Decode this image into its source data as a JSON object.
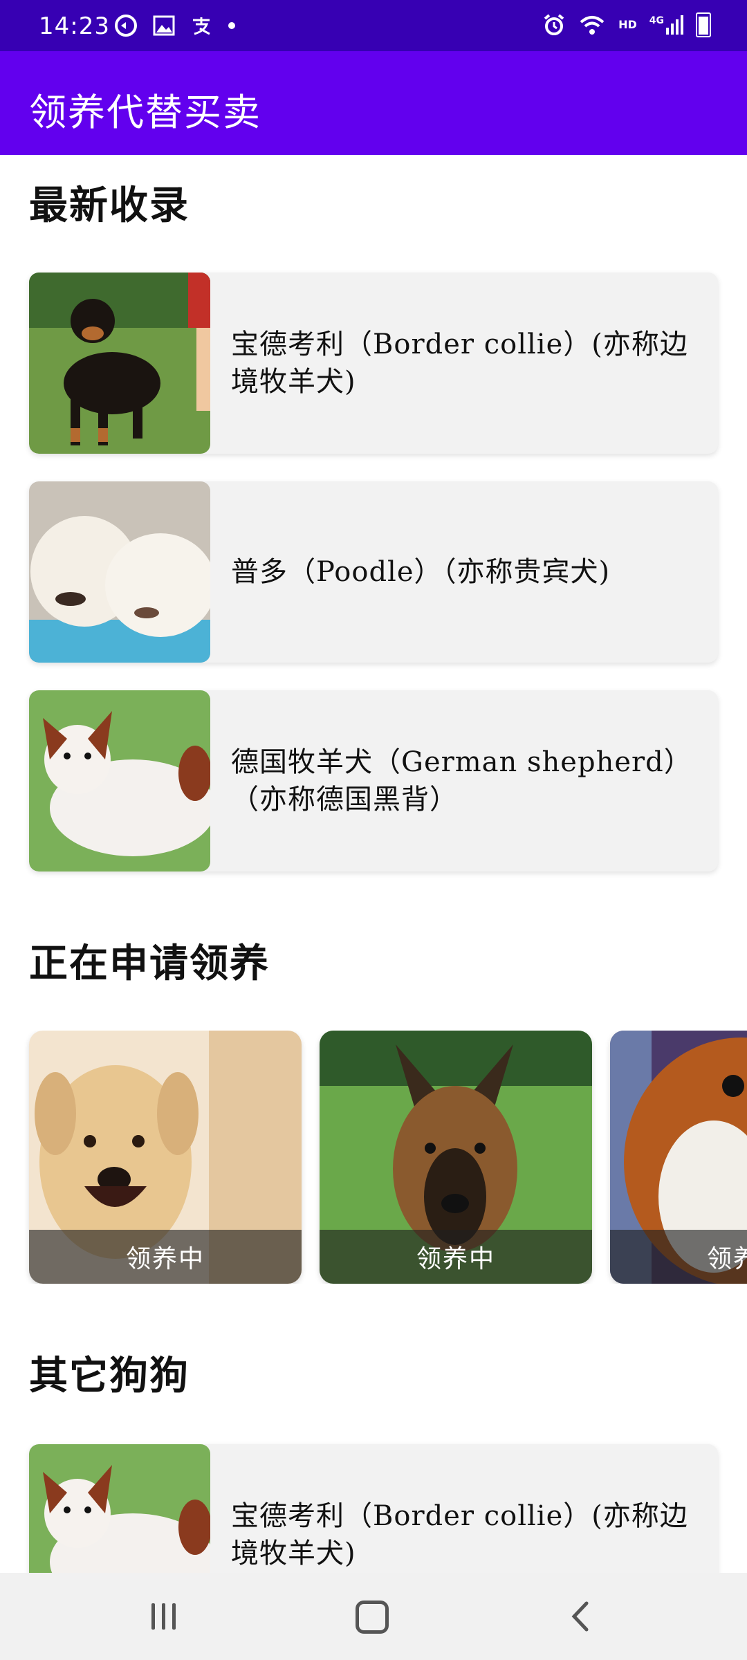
{
  "status_bar": {
    "time": "14:23",
    "left_icons": [
      "sync-icon",
      "image-icon",
      "alipay-icon",
      "dot-icon"
    ],
    "right_icons": [
      "alarm-icon",
      "wifi-icon",
      "hd-icon",
      "signal-4g-icon",
      "battery-icon"
    ],
    "hd_label": "HD",
    "network_label": "4G"
  },
  "app_bar": {
    "title": "领养代替买卖",
    "background": "#6200ee",
    "status_background": "#3700b3"
  },
  "sections": {
    "latest": {
      "title": "最新收录",
      "items": [
        {
          "text": "宝德考利（Border collie）(亦称边境牧羊犬)",
          "image": "rottweiler-photo"
        },
        {
          "text": "普多（Poodle）（亦称贵宾犬)",
          "image": "puppies-photo"
        },
        {
          "text": "德国牧羊犬（German shepherd）（亦称德国黑背）",
          "image": "papillon-photo"
        }
      ]
    },
    "applying": {
      "title": "正在申请领养",
      "items": [
        {
          "label": "领养中",
          "image": "labrador-photo"
        },
        {
          "label": "领养中",
          "image": "german-shepherd-photo"
        },
        {
          "label": "领养中",
          "image": "sheltie-photo"
        }
      ]
    },
    "others": {
      "title": "其它狗狗",
      "items": [
        {
          "text": "宝德考利（Border collie）(亦称边境牧羊犬)",
          "image": "papillon-photo"
        }
      ]
    }
  },
  "nav_bar": {
    "icons": [
      "recent-apps-icon",
      "home-icon",
      "back-icon"
    ]
  }
}
